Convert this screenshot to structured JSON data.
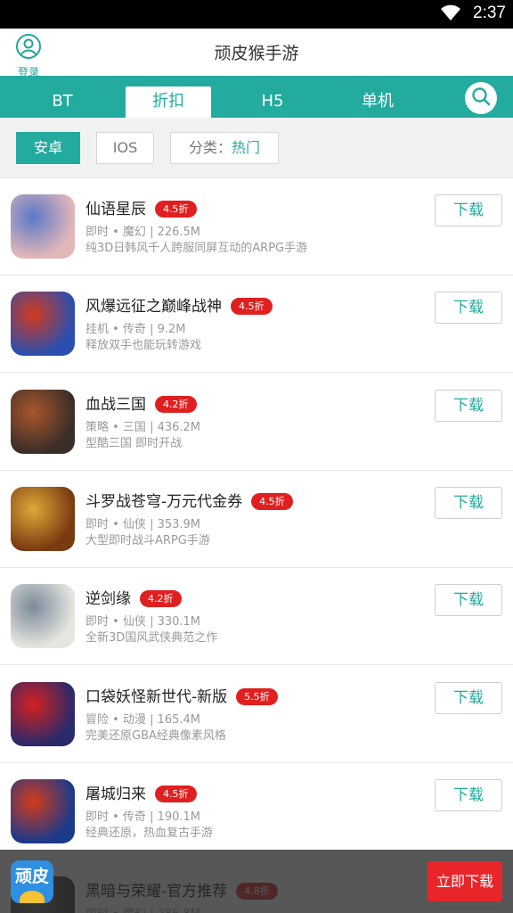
{
  "status_bar": {
    "time": "2:37"
  },
  "header": {
    "title": "顽皮猴手游",
    "login_label": "登录"
  },
  "tabs": [
    {
      "label": "BT",
      "active": false
    },
    {
      "label": "折扣",
      "active": true
    },
    {
      "label": "H5",
      "active": false
    },
    {
      "label": "单机",
      "active": false
    }
  ],
  "filters": {
    "platform_android": "安卓",
    "platform_ios": "IOS",
    "category_prefix": "分类：",
    "category_value": "热门"
  },
  "download_label": "下载",
  "games": [
    {
      "name": "仙语星辰",
      "discount": "4.5折",
      "meta": "即时 • 魔幻 | 226.5M",
      "desc": "纯3D日韩风千人跨服同屏互动的ARPG手游",
      "icon_color": "#e2b7b8",
      "icon_color2": "#5a78c8",
      "icon": "girl-avatar-icon"
    },
    {
      "name": "风爆远征之巅峰战神",
      "discount": "4.5折",
      "meta": "挂机 • 传奇 | 9.2M",
      "desc": "释放双手也能玩转游戏",
      "icon_color": "#2a4fb0",
      "icon_color2": "#d23a1c",
      "icon": "taiji-orb-icon"
    },
    {
      "name": "血战三国",
      "discount": "4.2折",
      "meta": "策略 • 三国 | 436.2M",
      "desc": "型酷三国 即时开战",
      "icon_color": "#3a2e28",
      "icon_color2": "#a8562c",
      "icon": "warrior-portrait-icon"
    },
    {
      "name": "斗罗战苍穹-万元代金券",
      "discount": "4.5折",
      "meta": "即时 • 仙侠 | 353.9M",
      "desc": "大型即时战斗ARPG手游",
      "icon_color": "#7a3a10",
      "icon_color2": "#e0a838",
      "icon": "golden-warrior-icon"
    },
    {
      "name": "逆剑缘",
      "discount": "4.2折",
      "meta": "即时 • 仙侠 | 330.1M",
      "desc": "全新3D国风武侠典范之作",
      "icon_color": "#e6e6e0",
      "icon_color2": "#7a8a9a",
      "icon": "sword-calligraphy-icon"
    },
    {
      "name": "口袋妖怪新世代-新版",
      "discount": "5.5折",
      "meta": "冒险 • 动漫 | 165.4M",
      "desc": "完美还原GBA经典像素风格",
      "icon_color": "#2a2a6a",
      "icon_color2": "#d42020",
      "icon": "pokeball-icon"
    },
    {
      "name": "屠城归来",
      "discount": "4.5折",
      "meta": "即时 • 传奇 | 190.1M",
      "desc": "经典还原，热血复古手游",
      "icon_color": "#1a3a8a",
      "icon_color2": "#d43a1a",
      "icon": "slaughter-city-logo-icon"
    },
    {
      "name": "黑暗与荣耀-官方推荐",
      "discount": "4.8折",
      "meta": "即时 • 魔幻 | 286.8M",
      "desc": "",
      "icon_color": "#333333",
      "icon_color2": "#777777",
      "icon": "dark-glory-icon"
    }
  ],
  "banner": {
    "logo_text": "顽皮",
    "button_label": "立即下载"
  },
  "colors": {
    "accent": "#22ab9e",
    "badge": "#e02020",
    "banner_button": "#e8262a"
  }
}
